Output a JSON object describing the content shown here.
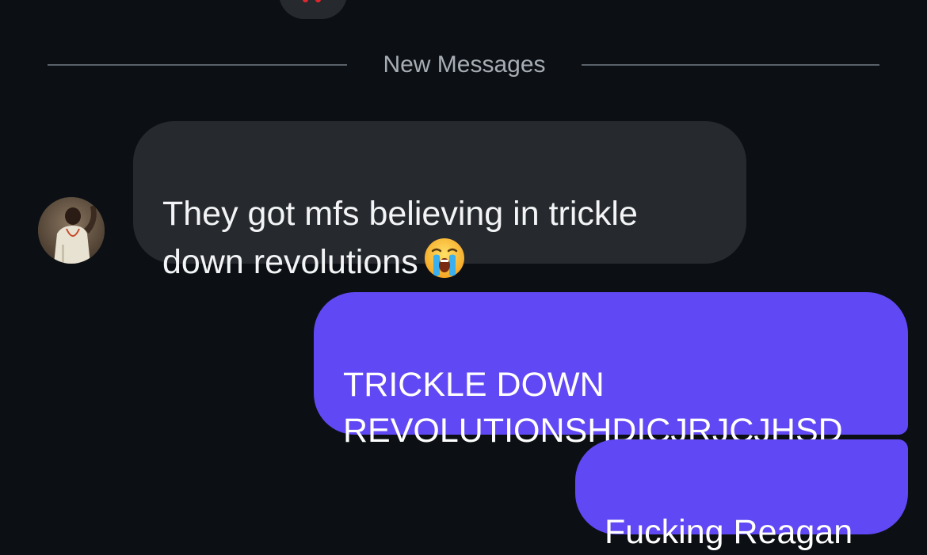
{
  "divider": {
    "label": "New Messages"
  },
  "messages": [
    {
      "direction": "incoming",
      "text": "They got mfs believing in trickle\ndown revolutions",
      "trailing_emoji": "loudly-crying-face"
    },
    {
      "direction": "outgoing",
      "text": "TRICKLE DOWN\nREVOLUTIONSHDICJRJCJHSD"
    },
    {
      "direction": "outgoing",
      "text": "Fucking Reagan"
    }
  ],
  "colors": {
    "background": "#0c1014",
    "incoming_bubble": "#26292e",
    "outgoing_bubble": "#6148f5",
    "divider_text": "#a7adb4"
  }
}
